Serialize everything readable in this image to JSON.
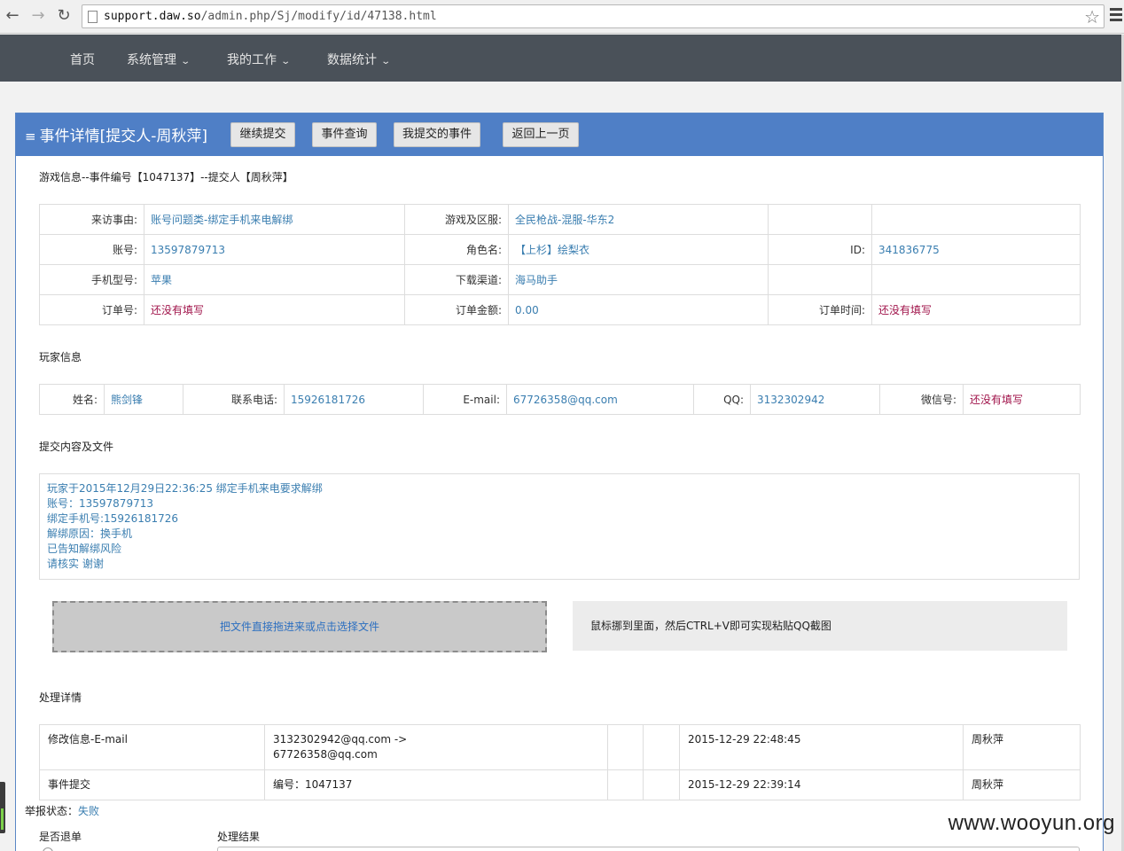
{
  "browser": {
    "url_host": "support.daw.so",
    "url_path": "/admin.php/Sj/modify/id/47138.html"
  },
  "nav": {
    "items": [
      "首页",
      "系统管理",
      "我的工作",
      "数据统计"
    ]
  },
  "panel": {
    "title": "事件详情[提交人-周秋萍]",
    "buttons": [
      "继续提交",
      "事件查询",
      "我提交的事件",
      "返回上一页"
    ]
  },
  "game_info": {
    "section_title": "游戏信息--事件编号【1047137】--提交人【周秋萍】",
    "rows": [
      [
        {
          "label": "来访事由:",
          "value": "账号问题类-绑定手机来电解绑"
        },
        {
          "label": "游戏及区服:",
          "value": "全民枪战-混服-华东2"
        },
        {
          "label": "",
          "value": ""
        }
      ],
      [
        {
          "label": "账号:",
          "value": "13597879713"
        },
        {
          "label": "角色名:",
          "value": "【上杉】绘梨衣"
        },
        {
          "label": "ID:",
          "value": "341836775"
        }
      ],
      [
        {
          "label": "手机型号:",
          "value": "苹果"
        },
        {
          "label": "下载渠道:",
          "value": "海马助手"
        },
        {
          "label": "",
          "value": ""
        }
      ],
      [
        {
          "label": "订单号:",
          "value": "还没有填写"
        },
        {
          "label": "订单金额:",
          "value": "0.00"
        },
        {
          "label": "订单时间:",
          "value": "还没有填写"
        }
      ]
    ]
  },
  "player_info": {
    "section_title": "玩家信息",
    "fields": [
      {
        "label": "姓名:",
        "value": "熊剑锋"
      },
      {
        "label": "联系电话:",
        "value": "15926181726"
      },
      {
        "label": "E-mail:",
        "value": "67726358@qq.com"
      },
      {
        "label": "QQ:",
        "value": "3132302942"
      },
      {
        "label": "微信号:",
        "value": "还没有填写"
      }
    ]
  },
  "submission": {
    "section_title": "提交内容及文件",
    "lines": [
      "玩家于2015年12月29日22:36:25 绑定手机来电要求解绑",
      "账号：13597879713",
      "绑定手机号:15926181726",
      "解绑原因：换手机",
      "已告知解绑风险",
      "请核实 谢谢"
    ],
    "dropzone_text": "把文件直接拖进来或点击选择文件",
    "paste_hint": "鼠标挪到里面，然后CTRL+V即可实现粘贴QQ截图"
  },
  "processing": {
    "section_title": "处理详情",
    "rows": [
      {
        "action": "修改信息-E-mail",
        "detail_1": "3132302942@qq.com ->",
        "detail_2": "67726358@qq.com",
        "time": "2015-12-29 22:48:45",
        "operator": "周秋萍"
      },
      {
        "action": "事件提交",
        "detail_1": "编号：1047137",
        "detail_2": "",
        "time": "2015-12-29 22:39:14",
        "operator": "周秋萍"
      }
    ]
  },
  "status": {
    "label": "举报状态：",
    "value": "失败",
    "refund_label": "是否退单",
    "result_label": "处理结果"
  },
  "watermark": "www.wooyun.org"
}
